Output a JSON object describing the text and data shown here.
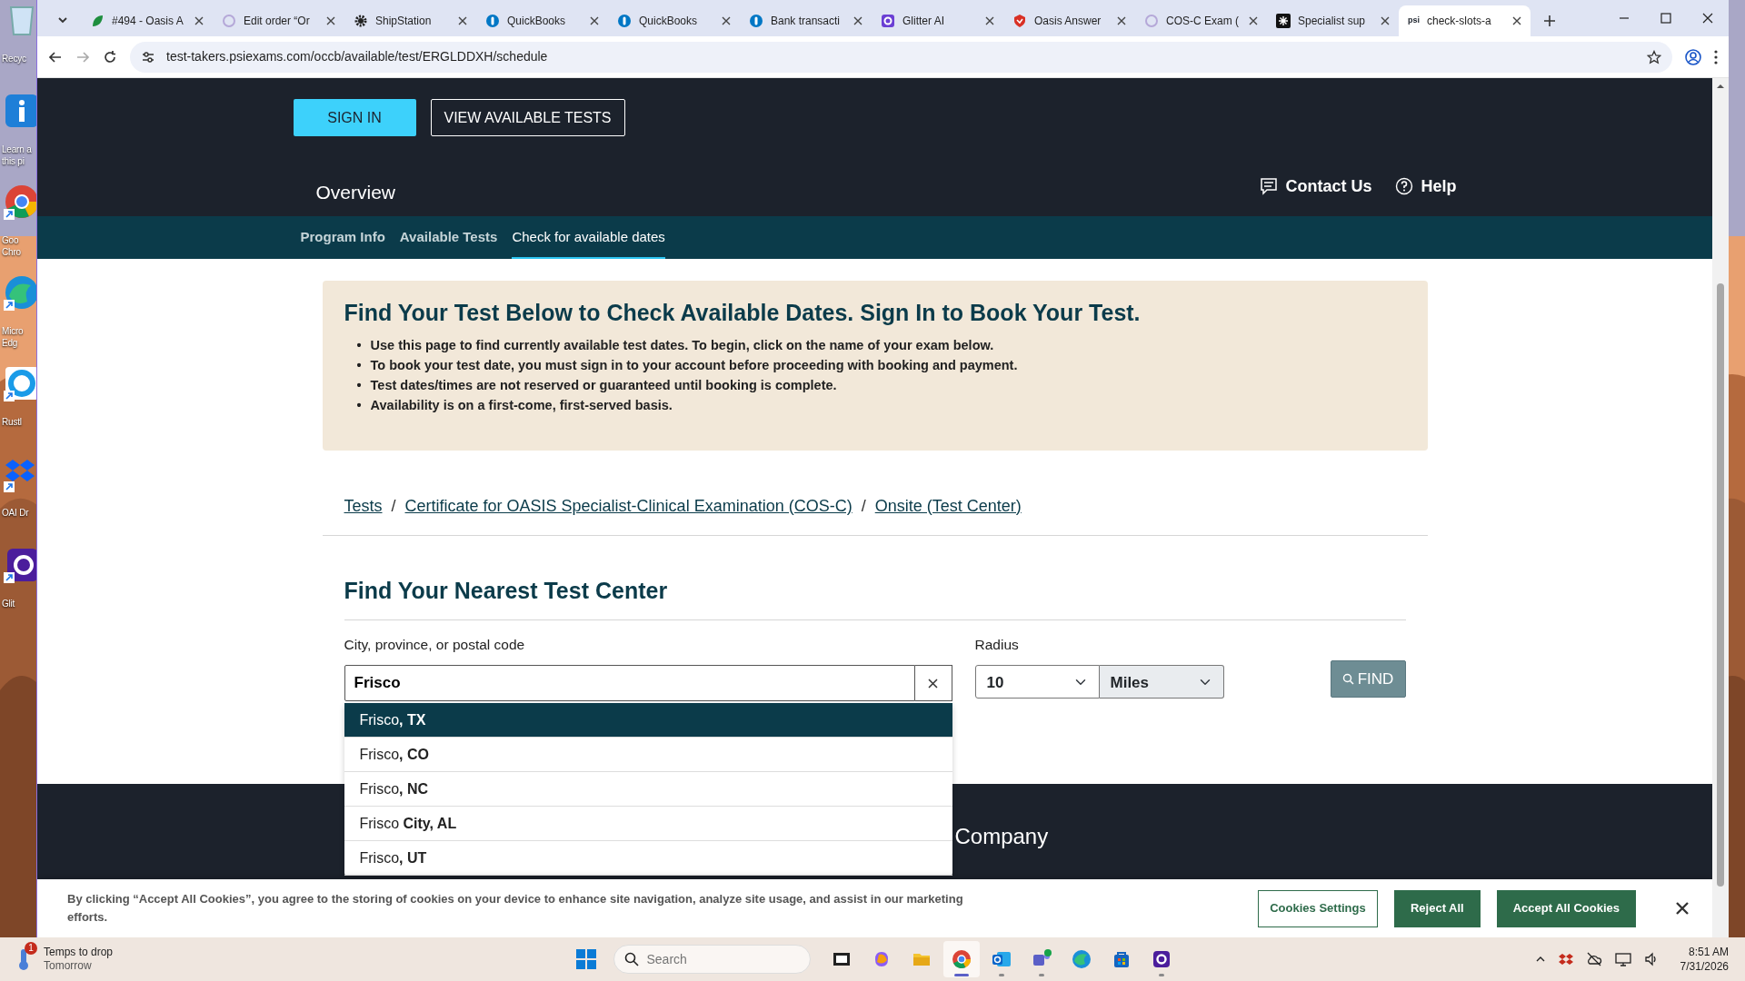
{
  "desktop_icons": [
    {
      "kind": "bin",
      "lines": [
        "Recyc"
      ]
    },
    {
      "kind": "info",
      "lines": [
        "Learn a",
        "this pi"
      ]
    },
    {
      "kind": "chrome",
      "lines": [
        "Goo",
        "Chro"
      ]
    },
    {
      "kind": "edge",
      "lines": [
        "Micro",
        "Edg"
      ]
    },
    {
      "kind": "rust",
      "lines": [
        "Rustl"
      ]
    },
    {
      "kind": "dropbox",
      "lines": [
        "OAI Dr"
      ]
    },
    {
      "kind": "glitter",
      "lines": [
        "Glit"
      ]
    }
  ],
  "browser": {
    "tabs": [
      {
        "title": "#494 - Oasis A",
        "kind": "leaf",
        "selected": false
      },
      {
        "title": "Edit order “Or",
        "kind": "swirl",
        "selected": false
      },
      {
        "title": "ShipStation",
        "kind": "gear",
        "selected": false
      },
      {
        "title": "QuickBooks",
        "kind": "qb",
        "selected": false
      },
      {
        "title": "QuickBooks",
        "kind": "qb",
        "selected": false
      },
      {
        "title": "Bank transacti",
        "kind": "qb",
        "selected": false
      },
      {
        "title": "Glitter AI",
        "kind": "glitter",
        "selected": false
      },
      {
        "title": "Oasis Answer",
        "kind": "oasis",
        "selected": false
      },
      {
        "title": "COS-C Exam (",
        "kind": "swirl",
        "selected": false
      },
      {
        "title": "Specialist sup",
        "kind": "spark",
        "selected": false
      },
      {
        "title": "check-slots-a",
        "kind": "psi",
        "logo_text": "psi",
        "selected": true
      }
    ],
    "url": "test-takers.psiexams.com/occb/available/test/ERGLDDXH/schedule"
  },
  "header": {
    "buttons": [
      {
        "label": "SIGN IN",
        "kind": "primary"
      },
      {
        "label": "VIEW AVAILABLE TESTS",
        "kind": "outline"
      }
    ],
    "title": "Overview",
    "links": [
      {
        "label": "Contact Us",
        "kind": "chat"
      },
      {
        "label": "Help",
        "kind": "help"
      }
    ]
  },
  "subnav": [
    {
      "label": "Program Info",
      "selected": false
    },
    {
      "label": "Available Tests",
      "selected": false
    },
    {
      "label": "Check for available dates",
      "selected": true
    }
  ],
  "notice": {
    "title": "Find Your Test Below to Check Available Dates. Sign In to Book Your Test.",
    "bullets": [
      {
        "marker": "•",
        "text": "Use this page to find currently available test dates. To begin, click on the name of your exam below."
      },
      {
        "marker": "•",
        "text": "To book your test date, you must sign in to your account before proceeding with booking and payment."
      },
      {
        "marker": "•",
        "text": "Test dates/times are not reserved or guaranteed until booking is complete."
      },
      {
        "marker": "•",
        "text": "Availability is on a first-come, first-served basis."
      }
    ]
  },
  "breadcrumb": [
    {
      "kind": "link",
      "text": "Tests"
    },
    {
      "kind": "separator",
      "text": "/"
    },
    {
      "kind": "link",
      "text": "Certificate for OASIS Specialist-Clinical Examination (COS-C)"
    },
    {
      "kind": "separator",
      "text": "/"
    },
    {
      "kind": "link",
      "text": "Onsite (Test Center)"
    }
  ],
  "search": {
    "title": "Find Your Nearest Test Center",
    "location_label": "City, province, or postal code",
    "location_value": "Frisco",
    "radius_label": "Radius",
    "radius": "10",
    "unit": "Miles",
    "find_button": "FIND",
    "suggestions": [
      {
        "text": "Frisco**, TX**",
        "selected": true
      },
      {
        "text": "Frisco**, CO**",
        "selected": false
      },
      {
        "text": "Frisco**, NC**",
        "selected": false
      },
      {
        "text": "Frisco **City, AL**",
        "selected": false
      },
      {
        "text": "Frisco**, UT**",
        "selected": false
      }
    ]
  },
  "footer": {
    "heading": "Company"
  },
  "cookie_banner": {
    "text": "By clicking “Accept All Cookies”, you agree to the storing of cookies on your device to enhance site navigation, analyze site usage, and assist in our marketing efforts.",
    "buttons": [
      {
        "label": "Cookies Settings",
        "kind": "outline"
      },
      {
        "label": "Reject All",
        "kind": "solid"
      },
      {
        "label": "Accept All Cookies",
        "kind": "solid"
      }
    ]
  },
  "taskbar": {
    "weather": {
      "title": "Temps to drop",
      "subtitle": "Tomorrow",
      "badge": "1"
    },
    "search_placeholder": "Search",
    "apps": [
      {
        "kind": "taskview",
        "running": false,
        "selected": false
      },
      {
        "kind": "copilot",
        "running": false,
        "selected": false
      },
      {
        "kind": "explorer",
        "running": false,
        "selected": false
      },
      {
        "kind": "chrome",
        "running": true,
        "selected": true
      },
      {
        "kind": "outlook",
        "running": true,
        "selected": false
      },
      {
        "kind": "teams",
        "running": true,
        "selected": false
      },
      {
        "kind": "edge",
        "running": false,
        "selected": false
      },
      {
        "kind": "store",
        "running": false,
        "selected": false
      },
      {
        "kind": "glitter",
        "running": true,
        "selected": false
      }
    ],
    "time": "8:51 AM",
    "date": "7/31/2026"
  }
}
